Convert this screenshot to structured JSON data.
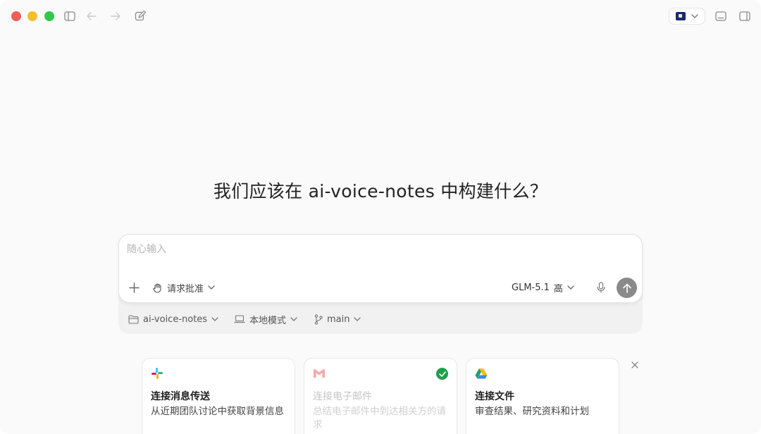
{
  "titlebar": {
    "icons": [
      "sidebar-toggle-icon",
      "back-arrow-icon",
      "forward-arrow-icon",
      "new-chat-icon",
      "flag-icon",
      "chevron-down-icon",
      "terminal-panel-icon",
      "right-panel-icon"
    ]
  },
  "main": {
    "heading": "我们应该在 ai-voice-notes 中构建什么？"
  },
  "composer": {
    "placeholder": "随心输入",
    "approval_label": "请求批准",
    "model_label": "GLM-5.1",
    "effort_label": "高"
  },
  "context": {
    "project": "ai-voice-notes",
    "mode": "本地模式",
    "branch": "main"
  },
  "cards": [
    {
      "title": "连接消息传送",
      "desc": "从近期团队讨论中获取背景信息",
      "icon": "slack-icon",
      "enabled": true
    },
    {
      "title": "连接电子邮件",
      "desc": "总结电子邮件中到达相关方的请求",
      "icon": "gmail-icon",
      "enabled": false,
      "connected": true
    },
    {
      "title": "连接文件",
      "desc": "审查结果、研究资料和计划",
      "icon": "drive-icon",
      "enabled": true
    }
  ],
  "colors": {
    "close": "#ed5f58",
    "minimize": "#f4bd2f",
    "maximize": "#34c748",
    "send": "#8a8a8a",
    "check": "#1f9e4a"
  }
}
